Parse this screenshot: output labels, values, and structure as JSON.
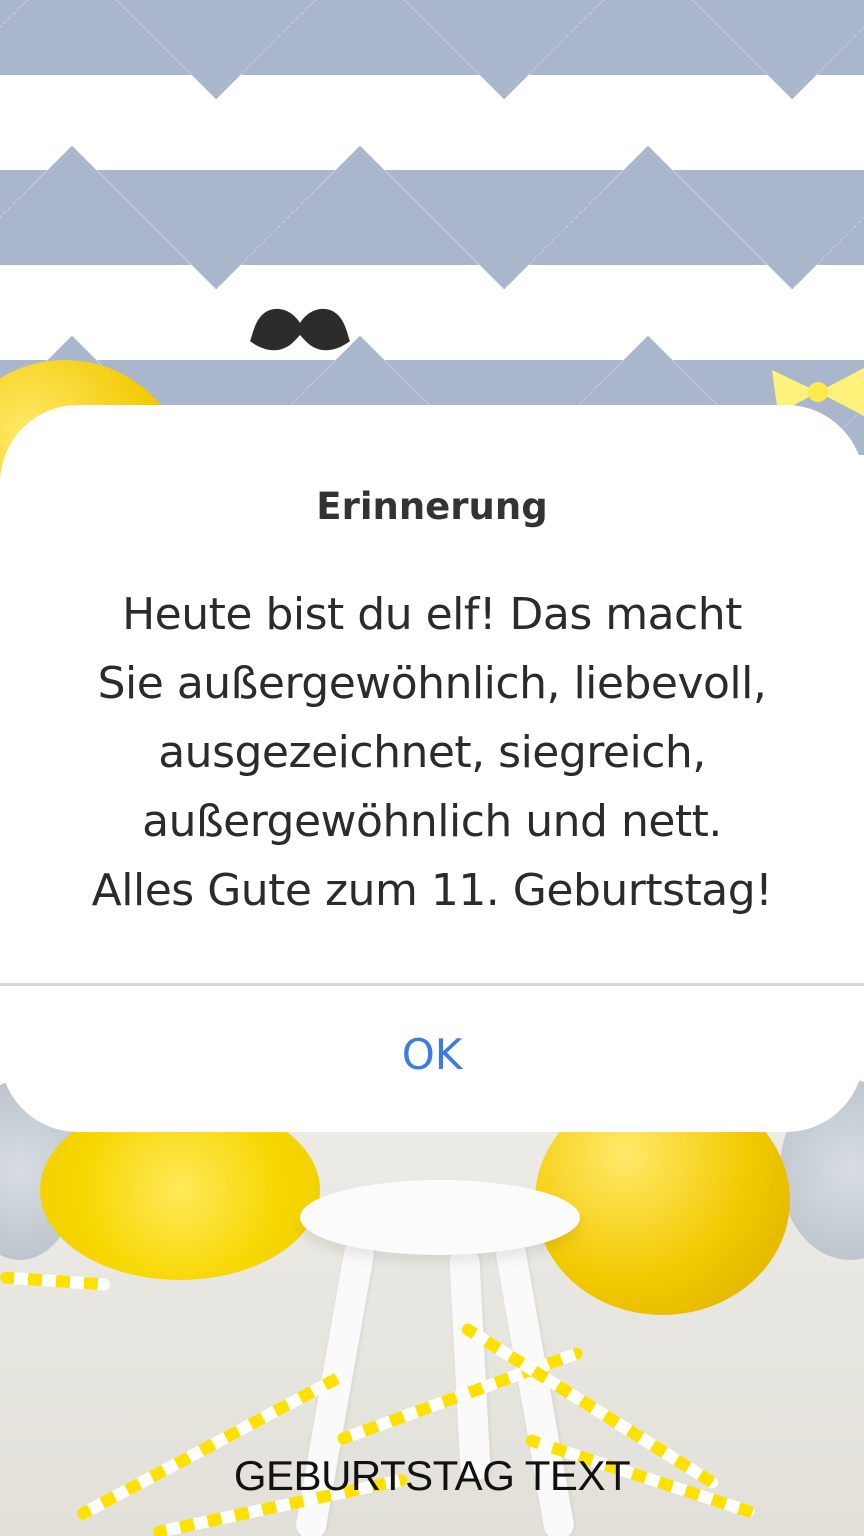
{
  "dialog": {
    "title": "Erinnerung",
    "message_lines": [
      "Heute bist du elf! Das macht",
      "Sie außergewöhnlich, liebevoll,",
      "ausgezeichnet, siegreich,",
      "außergewöhnlich und nett.",
      "Alles Gute zum 11. Geburtstag!"
    ],
    "ok_label": "OK"
  },
  "footer": {
    "label": "GEBURTSTAG TEXT"
  },
  "colors": {
    "accent": "#3d7be0",
    "dialog_background": "#ffffff",
    "chevron_blue": "#a9b6cc",
    "balloon_yellow": "#f2c900"
  },
  "icons": {
    "decoration": "mustache-icon"
  }
}
